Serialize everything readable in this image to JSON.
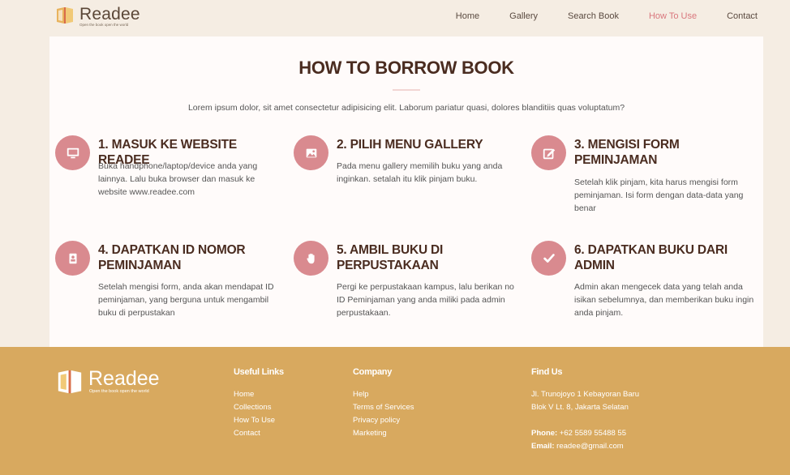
{
  "brand": {
    "name": "Readee",
    "tagline": "Open the book open the world"
  },
  "nav": {
    "items": [
      {
        "label": "Home"
      },
      {
        "label": "Gallery"
      },
      {
        "label": "Search Book"
      },
      {
        "label": "How To Use",
        "active": true
      },
      {
        "label": "Contact"
      }
    ]
  },
  "section": {
    "title": "HOW TO BORROW BOOK",
    "intro": "Lorem ipsum dolor, sit amet consectetur adipisicing elit. Laborum pariatur quasi, dolores blanditiis quas voluptatum?"
  },
  "steps": [
    {
      "icon": "monitor-icon",
      "title": "1. MASUK KE WEBSITE READEE",
      "desc": "Buka handphone/laptop/device anda yang lainnya. Lalu buka browser dan masuk ke website www.readee.com"
    },
    {
      "icon": "image-icon",
      "title": "2. PILIH MENU GALLERY",
      "desc": "Pada menu gallery memilih buku yang anda inginkan. setalah itu klik pinjam buku."
    },
    {
      "icon": "edit-form-icon",
      "title": "3. MENGISI FORM PEMINJAMAN",
      "desc": "Setelah klik pinjam, kita harus mengisi form peminjaman. Isi form dengan data-data yang benar"
    },
    {
      "icon": "id-card-icon",
      "title": "4. DAPATKAN ID NOMOR PEMINJAMAN",
      "desc": "Setelah mengisi form, anda akan mendapat ID peminjaman, yang berguna untuk mengambil buku di perpustakan"
    },
    {
      "icon": "hand-icon",
      "title": "5. AMBIL BUKU DI PERPUSTAKAAN",
      "desc": "Pergi ke perpustakaan kampus, lalu berikan no ID Peminjaman yang anda miliki pada admin perpustakaan."
    },
    {
      "icon": "check-icon",
      "title": "6. DAPATKAN BUKU DARI ADMIN",
      "desc": "Admin akan mengecek data yang telah anda isikan sebelumnya, dan memberikan buku ingin anda pinjam."
    }
  ],
  "footer": {
    "useful_links": {
      "heading": "Useful Links",
      "links": [
        "Home",
        "Collections",
        "How To Use",
        "Contact"
      ]
    },
    "company": {
      "heading": "Company",
      "links": [
        "Help",
        "Terms of Services",
        "Privacy policy",
        "Marketing"
      ]
    },
    "find_us": {
      "heading": "Find Us",
      "address_line1": "Jl. Trunojoyo 1 Kebayoran Baru",
      "address_line2": "Blok V Lt. 8, Jakarta Selatan",
      "phone_label": "Phone:",
      "phone": "+62 5589 55488 55",
      "email_label": "Email:",
      "email": "readee@gmail.com"
    }
  },
  "colors": {
    "accent": "#d9777d",
    "icon_circle": "#d98a8f",
    "footer_bg": "#d8a95f",
    "heading": "#4a2c20"
  }
}
